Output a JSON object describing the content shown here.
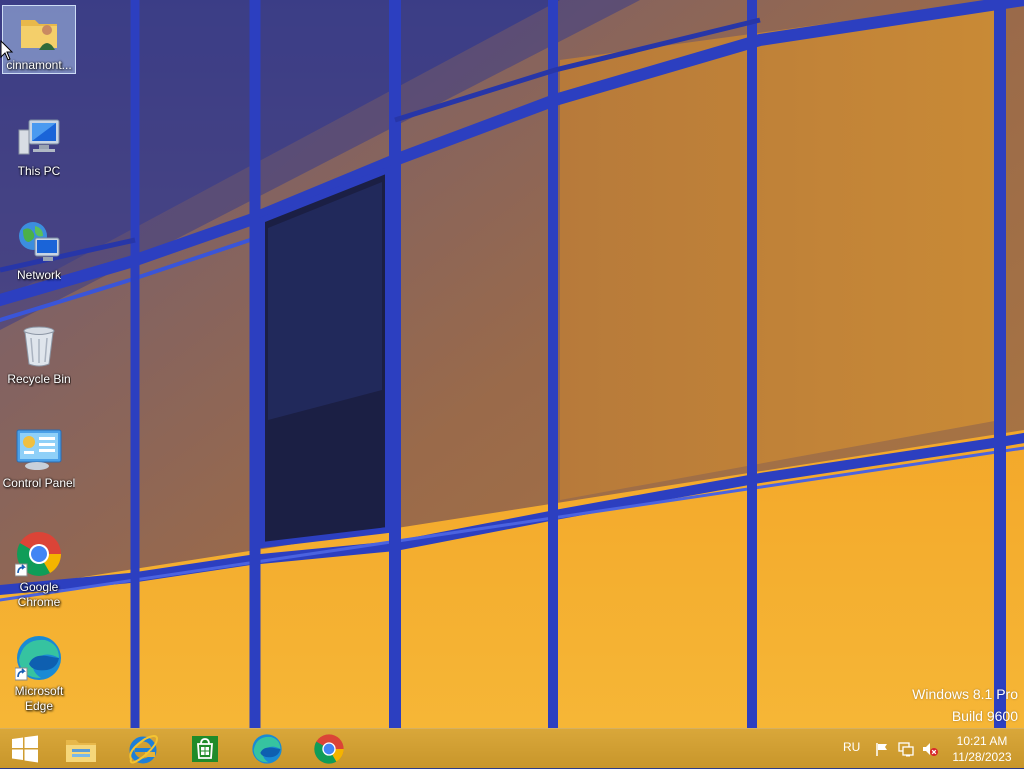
{
  "desktop": {
    "icons": [
      {
        "label": "cinnamont...",
        "icon": "user-folder-icon",
        "selected": true
      },
      {
        "label": "This PC",
        "icon": "this-pc-icon"
      },
      {
        "label": "Network",
        "icon": "network-icon"
      },
      {
        "label": "Recycle Bin",
        "icon": "recycle-bin-icon"
      },
      {
        "label": "Control Panel",
        "icon": "control-panel-icon"
      },
      {
        "label": "Google Chrome",
        "icon": "google-chrome-icon",
        "shortcut": true
      },
      {
        "label": "Microsoft Edge",
        "icon": "microsoft-edge-icon",
        "shortcut": true
      }
    ]
  },
  "watermark": {
    "line1": "Windows 8.1 Pro",
    "line2": "Build 9600"
  },
  "taskbar": {
    "pinned": [
      "start-button",
      "file-explorer-icon",
      "internet-explorer-icon",
      "store-icon",
      "microsoft-edge-icon",
      "google-chrome-icon"
    ],
    "language": "RU",
    "tray_icons": [
      "action-center-flag-icon",
      "network-tray-icon",
      "speaker-muted-icon"
    ],
    "clock_time": "10:21 AM",
    "clock_date": "11/28/2023"
  },
  "colors": {
    "taskbar": "#c8962b",
    "frame_blue": "#2c3fc0",
    "glass_orange": "#f0a020",
    "glass_purple": "#5a5a9a"
  }
}
